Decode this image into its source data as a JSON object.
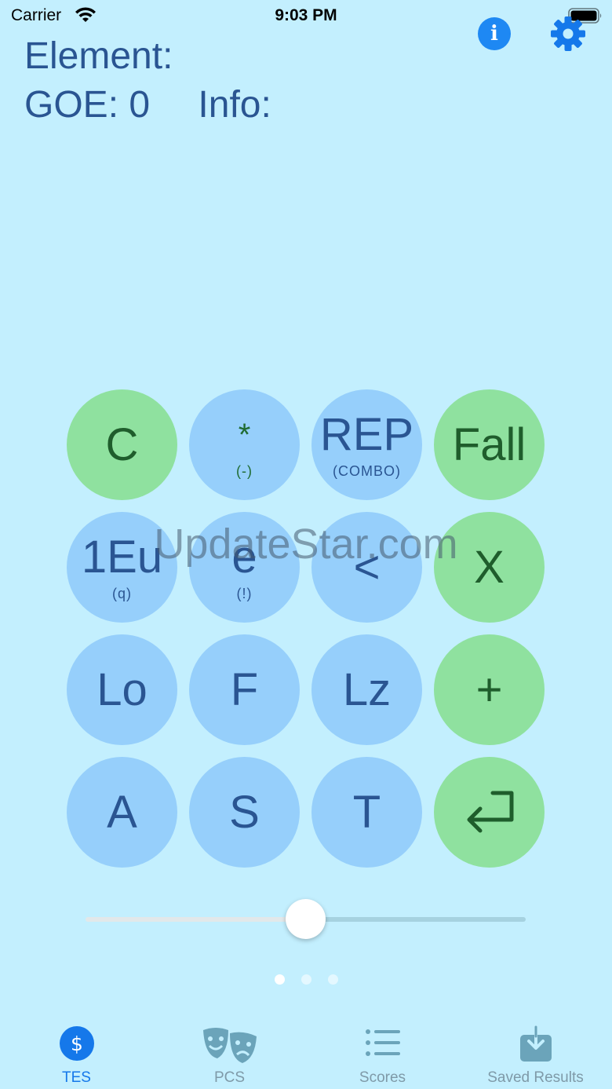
{
  "status_bar": {
    "carrier": "Carrier",
    "time": "9:03 PM"
  },
  "header": {
    "element_label": "Element:",
    "goe_label": "GOE: 0",
    "info_label": "Info:"
  },
  "keys": [
    {
      "main": "C",
      "sub": "",
      "color": "green"
    },
    {
      "main": "*",
      "sub": "(-)",
      "color": "blue"
    },
    {
      "main": "REP",
      "sub": "(COMBO)",
      "color": "blue"
    },
    {
      "main": "Fall",
      "sub": "",
      "color": "green"
    },
    {
      "main": "1Eu",
      "sub": "(q)",
      "color": "blue"
    },
    {
      "main": "e",
      "sub": "(!)",
      "color": "blue"
    },
    {
      "main": "<",
      "sub": "",
      "color": "blue"
    },
    {
      "main": "X",
      "sub": "",
      "color": "green"
    },
    {
      "main": "Lo",
      "sub": "",
      "color": "blue"
    },
    {
      "main": "F",
      "sub": "",
      "color": "blue"
    },
    {
      "main": "Lz",
      "sub": "",
      "color": "blue"
    },
    {
      "main": "+",
      "sub": "",
      "color": "green"
    },
    {
      "main": "A",
      "sub": "",
      "color": "blue"
    },
    {
      "main": "S",
      "sub": "",
      "color": "blue"
    },
    {
      "main": "T",
      "sub": "",
      "color": "blue"
    },
    {
      "main": "",
      "sub": "",
      "color": "green",
      "icon": "return-icon"
    }
  ],
  "watermark": "UpdateStar.com",
  "slider": {
    "value_fraction": 0.5
  },
  "page_indicator": {
    "count": 3,
    "active": 0
  },
  "tabs": [
    {
      "label": "TES",
      "icon": "dollar-circle-icon",
      "active": true
    },
    {
      "label": "PCS",
      "icon": "theater-masks-icon",
      "active": false
    },
    {
      "label": "Scores",
      "icon": "list-icon",
      "active": false
    },
    {
      "label": "Saved Results",
      "icon": "download-tray-icon",
      "active": false
    }
  ],
  "colors": {
    "background": "#c3effe",
    "key_blue": "#96cffb",
    "key_green": "#8fe19f",
    "accent": "#1578ea",
    "text": "#2a5592"
  }
}
